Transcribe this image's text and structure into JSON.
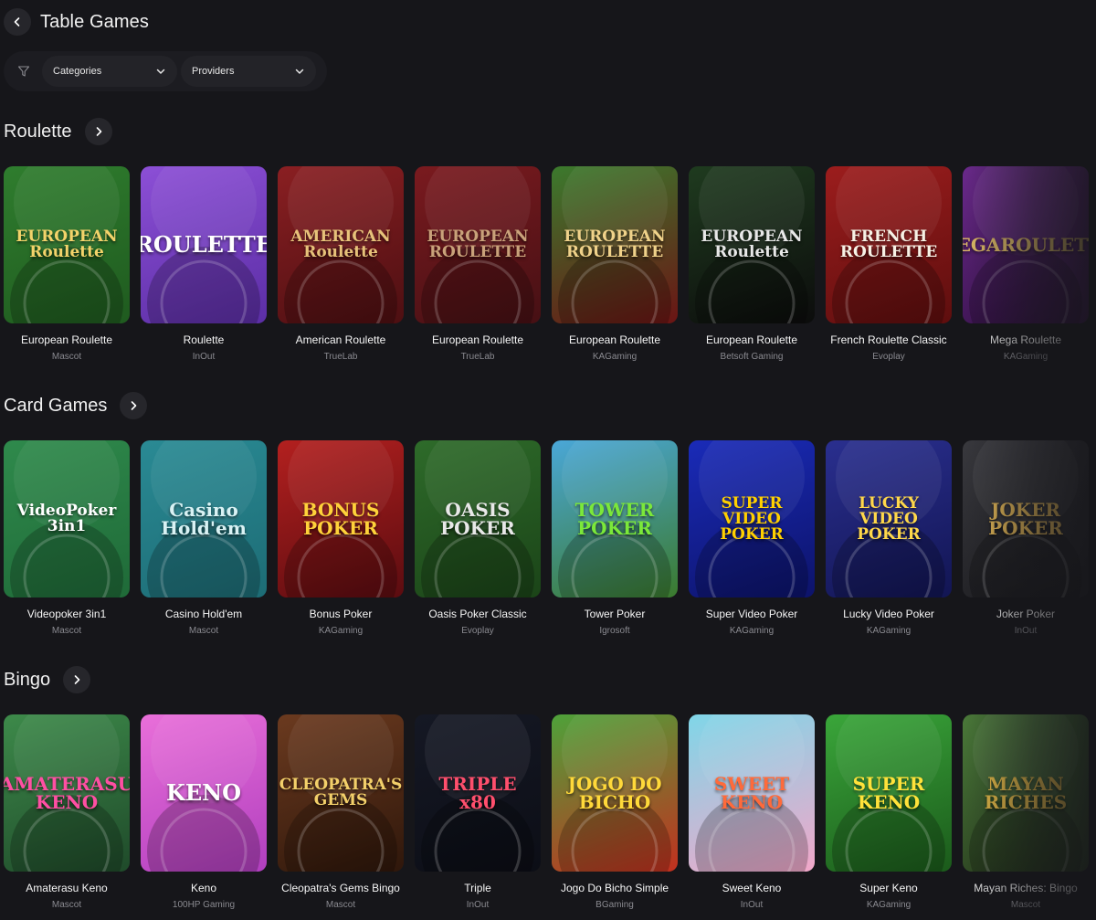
{
  "page": {
    "title": "Table Games"
  },
  "filters": {
    "categories_label": "Categories",
    "providers_label": "Providers"
  },
  "sections": [
    {
      "title": "Roulette",
      "games": [
        {
          "name": "European Roulette",
          "provider": "Mascot",
          "art": "EUROPEAN Roulette",
          "bg1": "#2f7d2e",
          "bg2": "#1f5a1f",
          "fg": "#f3d36a"
        },
        {
          "name": "Roulette",
          "provider": "InOut",
          "art": "ROULETTE",
          "bg1": "#8c4fd6",
          "bg2": "#5b2ea5",
          "fg": "#ffffff"
        },
        {
          "name": "American Roulette",
          "provider": "TrueLab",
          "art": "AMERICAN Roulette",
          "bg1": "#8a1f22",
          "bg2": "#4d0f12",
          "fg": "#e7c27a"
        },
        {
          "name": "European Roulette",
          "provider": "TrueLab",
          "art": "EUROPEAN ROULETTE",
          "bg1": "#7a1a1f",
          "bg2": "#461014",
          "fg": "#c9a27a"
        },
        {
          "name": "European Roulette",
          "provider": "KAGaming",
          "art": "EUROPEAN ROULETTE",
          "bg1": "#3b7a2d",
          "bg2": "#6b1414",
          "fg": "#f0d28a"
        },
        {
          "name": "European Roulette",
          "provider": "Betsoft Gaming",
          "art": "EUROPEAN Roulette",
          "bg1": "#1f3b1f",
          "bg2": "#0c0c0c",
          "fg": "#e8e8e8"
        },
        {
          "name": "French Roulette Classic",
          "provider": "Evoplay",
          "art": "FRENCH ROULETTE",
          "bg1": "#9c1d1d",
          "bg2": "#5e0e0e",
          "fg": "#f7f2e6"
        },
        {
          "name": "Mega Roulette",
          "provider": "KAGaming",
          "art": "MEGAROULETTE",
          "bg1": "#6d2a8f",
          "bg2": "#3a124e",
          "fg": "#e6c169"
        }
      ]
    },
    {
      "title": "Card Games",
      "games": [
        {
          "name": "Videopoker 3in1",
          "provider": "Mascot",
          "art": "VideoPoker 3in1",
          "bg1": "#2f8a4c",
          "bg2": "#1f6a38",
          "fg": "#ffffff"
        },
        {
          "name": "Casino Hold'em",
          "provider": "Mascot",
          "art": "Casino Hold'em",
          "bg1": "#2a8a94",
          "bg2": "#1d6c75",
          "fg": "#d9f2f4"
        },
        {
          "name": "Bonus Poker",
          "provider": "KAGaming",
          "art": "BONUS POKER",
          "bg1": "#b3201f",
          "bg2": "#5b0c10",
          "fg": "#ffd23a"
        },
        {
          "name": "Oasis Poker Classic",
          "provider": "Evoplay",
          "art": "OASIS POKER",
          "bg1": "#2e6b2a",
          "bg2": "#1b4418",
          "fg": "#e8e8e8"
        },
        {
          "name": "Tower Poker",
          "provider": "Igrosoft",
          "art": "TOWER POKER",
          "bg1": "#4aa7d8",
          "bg2": "#3b7a2d",
          "fg": "#7be83a"
        },
        {
          "name": "Super Video Poker",
          "provider": "KAGaming",
          "art": "SUPER VIDEO POKER",
          "bg1": "#1a2bb8",
          "bg2": "#0d136a",
          "fg": "#ffd000"
        },
        {
          "name": "Lucky Video Poker",
          "provider": "KAGaming",
          "art": "LUCKY VIDEO POKER",
          "bg1": "#2a2f8f",
          "bg2": "#121553",
          "fg": "#ffd84a"
        },
        {
          "name": "Joker Poker",
          "provider": "InOut",
          "art": "JOKER POKER",
          "bg1": "#3a3a3f",
          "bg2": "#1e1e22",
          "fg": "#f0c15a"
        }
      ]
    },
    {
      "title": "Bingo",
      "games": [
        {
          "name": "Amaterasu Keno",
          "provider": "Mascot",
          "art": "AMATERASU KENO",
          "bg1": "#3d8a4a",
          "bg2": "#1f4a2a",
          "fg": "#ff4fa3"
        },
        {
          "name": "Keno",
          "provider": "100HP Gaming",
          "art": "KENO",
          "bg1": "#e96fd9",
          "bg2": "#b13fbf",
          "fg": "#ffffff"
        },
        {
          "name": "Cleopatra's Gems Bingo",
          "provider": "Mascot",
          "art": "CLEOPATRA'S GEMS",
          "bg1": "#6b3a1f",
          "bg2": "#2f170b",
          "fg": "#f3d06a"
        },
        {
          "name": "Triple",
          "provider": "InOut",
          "art": "TRIPLE x80",
          "bg1": "#151824",
          "bg2": "#0c0e16",
          "fg": "#ff4f6d"
        },
        {
          "name": "Jogo Do Bicho Simple",
          "provider": "BGaming",
          "art": "JOGO DO BICHO",
          "bg1": "#4ea23a",
          "bg2": "#c2301f",
          "fg": "#ffd93a"
        },
        {
          "name": "Sweet Keno",
          "provider": "InOut",
          "art": "SWEET KENO",
          "bg1": "#7fd6e8",
          "bg2": "#f2a7c9",
          "fg": "#ff6a3a"
        },
        {
          "name": "Super Keno",
          "provider": "KAGaming",
          "art": "SUPER KENO",
          "bg1": "#3aa63a",
          "bg2": "#1b5a1b",
          "fg": "#ffe23a"
        },
        {
          "name": "Mayan Riches: Bingo",
          "provider": "Mascot",
          "art": "MAYAN RICHES",
          "bg1": "#4c7d3a",
          "bg2": "#2a3f1f",
          "fg": "#f0c34a"
        }
      ]
    }
  ]
}
